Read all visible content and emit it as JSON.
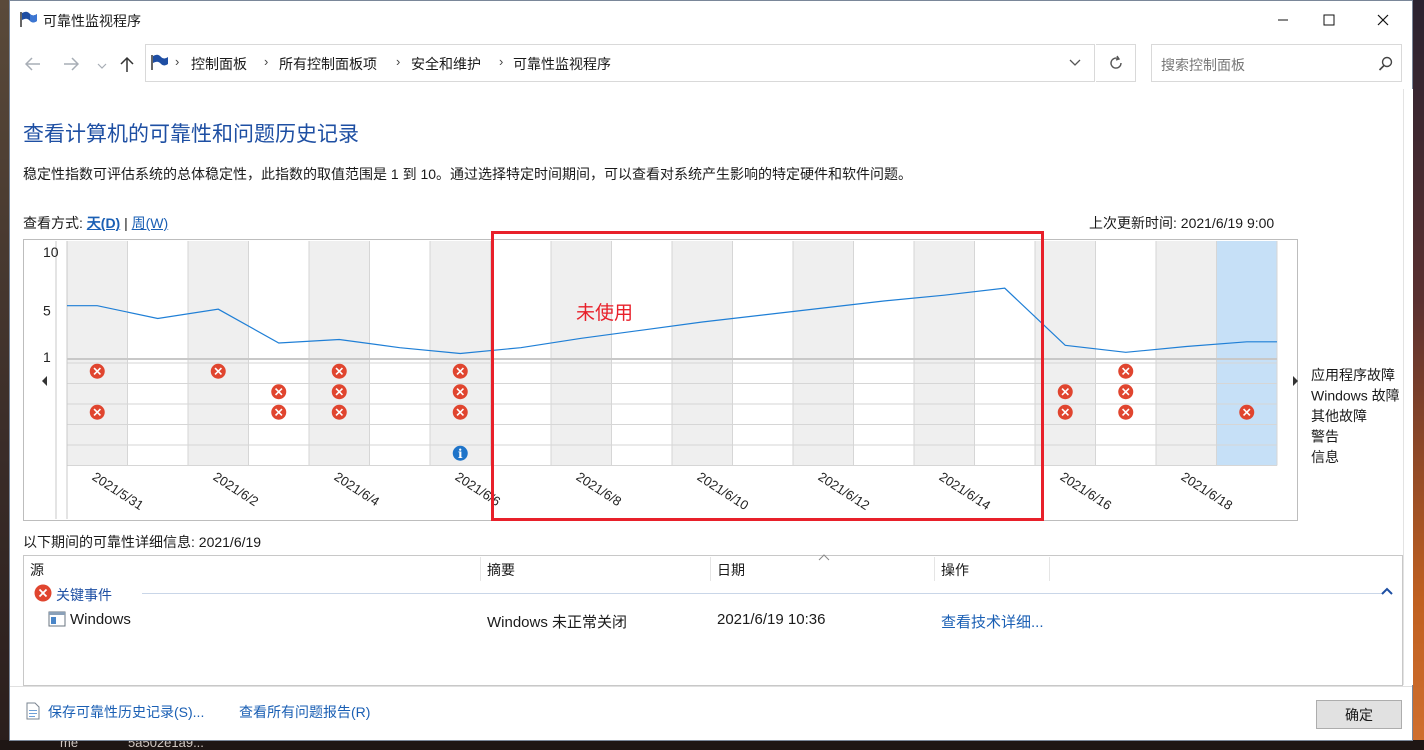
{
  "window": {
    "title": "可靠性监视程序"
  },
  "desktop": {
    "bottom_text_1": "me",
    "bottom_text_2": "5a502e1a9..."
  },
  "address": {
    "crumbs": [
      "控制面板",
      "所有控制面板项",
      "安全和维护",
      "可靠性监视程序"
    ],
    "search_placeholder": "搜索控制面板"
  },
  "page": {
    "title": "查看计算机的可靠性和问题历史记录",
    "description": "稳定性指数可评估系统的总体稳定性，此指数的取值范围是 1 到 10。通过选择特定时间期间，可以查看对系统产生影响的特定硬件和软件问题。",
    "view_by_label": "查看方式: ",
    "view_day": "天(D)",
    "view_sep": " | ",
    "view_week": "周(W)",
    "last_updated": "上次更新时间: 2021/6/19 9:00"
  },
  "chart_data": {
    "type": "line",
    "ylim": [
      1,
      10
    ],
    "yticks": [
      "10",
      "5",
      "1"
    ],
    "x": [
      "2021/5/31",
      "2021/6/1",
      "2021/6/2",
      "2021/6/3",
      "2021/6/4",
      "2021/6/5",
      "2021/6/6",
      "2021/6/7",
      "2021/6/8",
      "2021/6/9",
      "2021/6/10",
      "2021/6/11",
      "2021/6/12",
      "2021/6/13",
      "2021/6/14",
      "2021/6/15",
      "2021/6/16",
      "2021/6/17",
      "2021/6/18",
      "2021/6/19"
    ],
    "date_labels": [
      "2021/5/31",
      "2021/6/2",
      "2021/6/4",
      "2021/6/6",
      "2021/6/8",
      "2021/6/10",
      "2021/6/12",
      "2021/6/14",
      "2021/6/16",
      "2021/6/18"
    ],
    "series": [
      {
        "values": [
          5.4,
          4.3,
          5.1,
          2.2,
          2.5,
          1.8,
          1.3,
          1.8,
          2.6,
          3.3,
          4.0,
          4.6,
          5.2,
          5.8,
          6.3,
          6.9,
          2.0,
          1.4,
          1.9,
          2.3
        ]
      }
    ],
    "categories": [
      "应用程序故障",
      "Windows 故障",
      "其他故障",
      "警告",
      "信息"
    ],
    "events": [
      {
        "day": 0,
        "row": 0,
        "kind": "error"
      },
      {
        "day": 0,
        "row": 2,
        "kind": "error"
      },
      {
        "day": 2,
        "row": 0,
        "kind": "error"
      },
      {
        "day": 3,
        "row": 1,
        "kind": "error"
      },
      {
        "day": 3,
        "row": 2,
        "kind": "error"
      },
      {
        "day": 4,
        "row": 0,
        "kind": "error"
      },
      {
        "day": 4,
        "row": 1,
        "kind": "error"
      },
      {
        "day": 4,
        "row": 2,
        "kind": "error"
      },
      {
        "day": 6,
        "row": 0,
        "kind": "error"
      },
      {
        "day": 6,
        "row": 1,
        "kind": "error"
      },
      {
        "day": 6,
        "row": 2,
        "kind": "error"
      },
      {
        "day": 6,
        "row": 4,
        "kind": "info"
      },
      {
        "day": 16,
        "row": 1,
        "kind": "error"
      },
      {
        "day": 16,
        "row": 2,
        "kind": "error"
      },
      {
        "day": 17,
        "row": 0,
        "kind": "error"
      },
      {
        "day": 17,
        "row": 1,
        "kind": "error"
      },
      {
        "day": 17,
        "row": 2,
        "kind": "error"
      },
      {
        "day": 19,
        "row": 2,
        "kind": "error"
      }
    ],
    "selected_day": 19
  },
  "details": {
    "caption": "以下期间的可靠性详细信息: 2021/6/19",
    "col_source": "源",
    "col_summary": "摘要",
    "col_date": "日期",
    "col_action": "操作",
    "group_label": "关键事件",
    "rows": [
      {
        "source": "Windows",
        "summary": "Windows 未正常关闭",
        "date": "2021/6/19 10:36",
        "action": "查看技术详细..."
      }
    ]
  },
  "footer": {
    "save_link": "保存可靠性历史记录(S)...",
    "report_link": "查看所有问题报告(R)",
    "ok_label": "确定"
  },
  "annotation": {
    "text": "未使用",
    "color": "#e8202a"
  },
  "colors": {
    "accent": "#1e4fa3",
    "link": "#1a5fb4",
    "line": "#1f7fd6",
    "selected": "#c6e0f7",
    "stripe": "#efefef",
    "error": "#e0452f",
    "info": "#1f74c9"
  }
}
